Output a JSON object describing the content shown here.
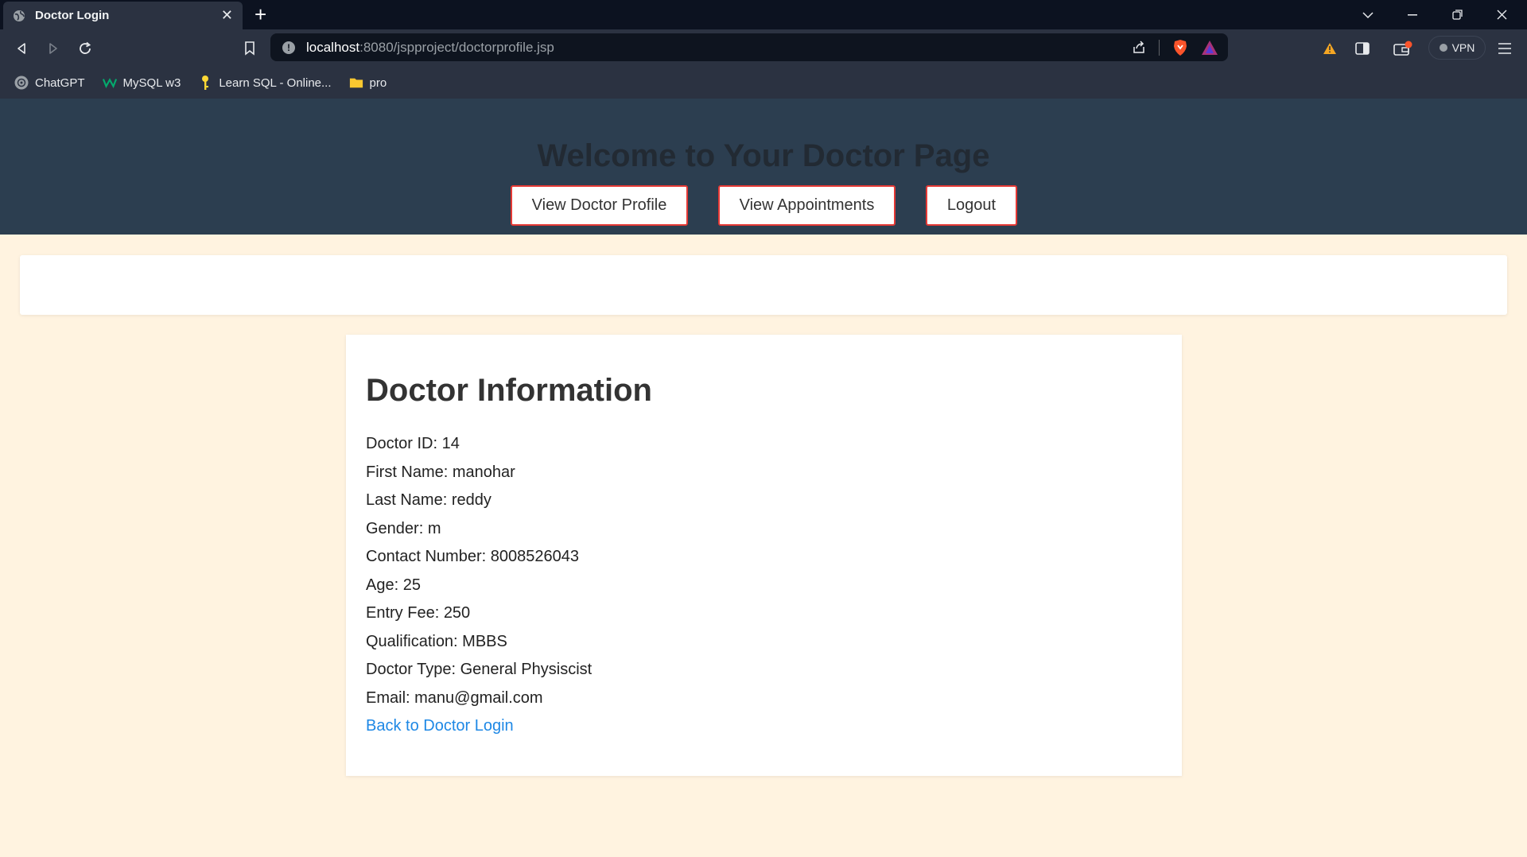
{
  "browser": {
    "tab_title": "Doctor Login",
    "url_host": "localhost",
    "url_rest": ":8080/jspproject/doctorprofile.jsp",
    "vpn_label": "VPN",
    "bookmarks": [
      {
        "label": "ChatGPT",
        "icon": "chatgpt-icon"
      },
      {
        "label": "MySQL w3",
        "icon": "w3schools-icon"
      },
      {
        "label": "Learn SQL - Online...",
        "icon": "key-icon"
      },
      {
        "label": "pro",
        "icon": "folder-icon"
      }
    ]
  },
  "header": {
    "title": "Welcome to Your Doctor Page",
    "nav": {
      "profile": "View Doctor Profile",
      "appointments": "View Appointments",
      "logout": "Logout"
    }
  },
  "profile": {
    "heading": "Doctor Information",
    "lines": [
      "Doctor ID: 14",
      "First Name: manohar",
      "Last Name: reddy",
      "Gender: m",
      "Contact Number: 8008526043",
      "Age: 25",
      "Entry Fee: 250",
      "Qualification: MBBS",
      "Doctor Type: General Physiscist",
      "Email: manu@gmail.com"
    ],
    "back_link": "Back to Doctor Login"
  },
  "colors": {
    "header_bg": "#2c3e50",
    "page_bg": "#fff3e0",
    "button_border": "#e53935",
    "link": "#1e88e5"
  }
}
